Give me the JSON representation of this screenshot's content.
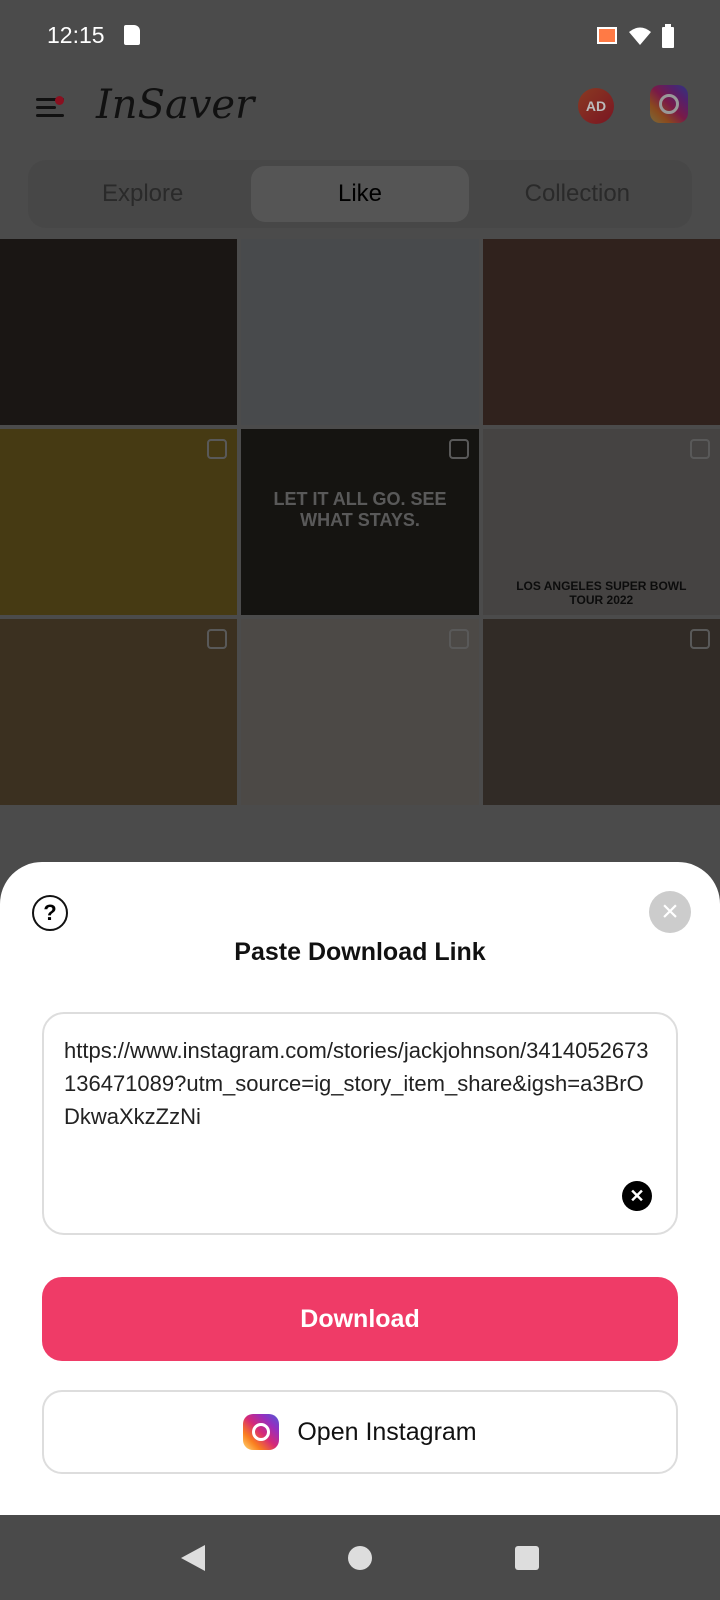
{
  "status": {
    "time": "12:15"
  },
  "header": {
    "logo": "InSaver",
    "ad_label": "AD"
  },
  "tabs": [
    {
      "label": "Explore"
    },
    {
      "label": "Like"
    },
    {
      "label": "Collection"
    }
  ],
  "grid": {
    "tiles": [
      "#4a3f3a",
      "#cfd4da",
      "#8a6252",
      "#c9a736",
      "#3c3a30",
      "#c5c0bc",
      "#a98a5a",
      "#d8d0c8",
      "#8c7c6c"
    ],
    "text_tile": "LET IT ALL GO. SEE WHAT STAYS.",
    "caption_tile": "LOS ANGELES SUPER BOWL TOUR 2022"
  },
  "sheet": {
    "title": "Paste Download Link",
    "link_value": "https://www.instagram.com/stories/jackjohnson/3414052673136471089?utm_source=ig_story_item_share&igsh=a3BrODkwaXkzZzNi",
    "download_label": "Download",
    "open_instagram_label": "Open Instagram"
  },
  "colors": {
    "accent": "#ef3b67"
  }
}
